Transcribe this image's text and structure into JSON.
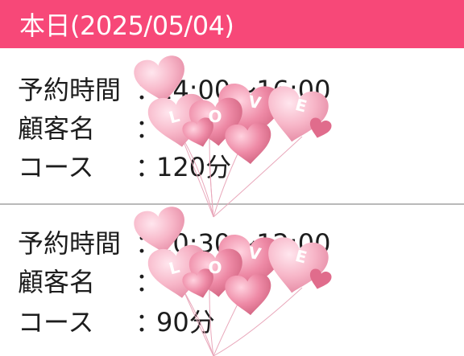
{
  "header": {
    "title": "本日(2025/05/04)"
  },
  "reservations": [
    {
      "time_label": "予約時間",
      "time_value": "14:00～16:00",
      "customer_label": "顧客名",
      "customer_value": "",
      "course_label": "コース",
      "course_value": "120分"
    },
    {
      "time_label": "予約時間",
      "time_value": "10:30～12:00",
      "customer_label": "顧客名",
      "customer_value": "",
      "course_label": "コース",
      "course_value": "90分"
    }
  ],
  "separator": "：",
  "sticker": {
    "text": "LOVE",
    "colors": [
      "#f7b6c8",
      "#ee8aa6",
      "#e06c8c"
    ]
  }
}
